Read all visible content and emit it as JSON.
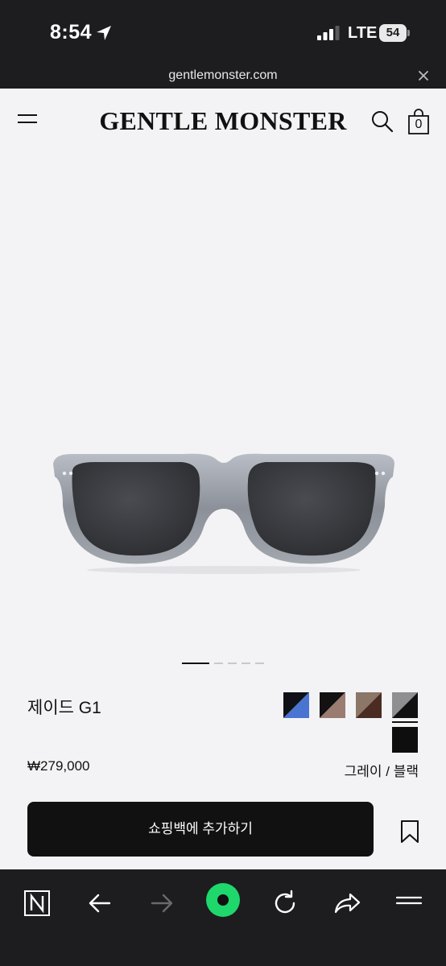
{
  "status_bar": {
    "time": "8:54",
    "network": "LTE",
    "battery": "54"
  },
  "browser": {
    "url": "gentlemonster.com"
  },
  "header": {
    "logo": "GENTLE MONSTER",
    "bag_count": "0"
  },
  "product": {
    "name": "제이드 G1",
    "price": "₩279,000",
    "selected_color": "그레이 / 블랙",
    "add_to_bag_label": "쇼핑백에 추가하기",
    "image_count": 5,
    "current_image": 1,
    "color_options": [
      {
        "name": "black-blue",
        "colors": [
          "#0f1117",
          "#4a74d1"
        ]
      },
      {
        "name": "black-brown",
        "colors": [
          "#131111",
          "#9a7d70"
        ]
      },
      {
        "name": "brown-brown",
        "colors": [
          "#8b7668",
          "#4b2c22"
        ]
      },
      {
        "name": "gray-black",
        "colors": [
          "#8f8f92",
          "#111111"
        ],
        "selected": true
      },
      {
        "name": "black",
        "colors": [
          "#0e0e0e",
          "#0e0e0e"
        ]
      }
    ]
  },
  "colors": {
    "toolbar_bg": "#1d1d1f",
    "accent_green": "#1ed86b",
    "button_bg": "#111111"
  }
}
